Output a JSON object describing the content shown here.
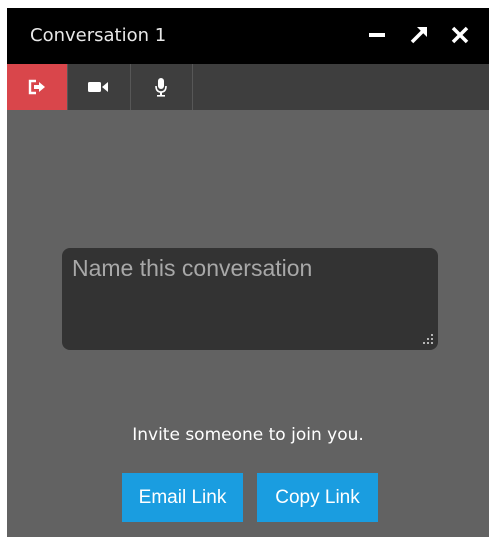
{
  "window": {
    "title": "Conversation 1"
  },
  "window_controls": {
    "minimize_icon": "minimize-icon",
    "maximize_icon": "maximize-arrow-icon",
    "close_icon": "close-icon"
  },
  "toolbar": {
    "items": [
      {
        "icon": "leave-conversation-icon",
        "active": true
      },
      {
        "icon": "video-camera-icon",
        "active": false
      },
      {
        "icon": "microphone-icon",
        "active": false
      }
    ]
  },
  "conversation": {
    "name_placeholder": "Name this conversation",
    "name_value": ""
  },
  "invite": {
    "text": "Invite someone to join you.",
    "email_button": "Email Link",
    "copy_button": "Copy Link"
  },
  "colors": {
    "titlebar": "#000000",
    "toolbar": "#3e3e3e",
    "active_tool": "#d9464b",
    "body": "#626262",
    "input_bg": "#333333",
    "button": "#1a9de0"
  }
}
